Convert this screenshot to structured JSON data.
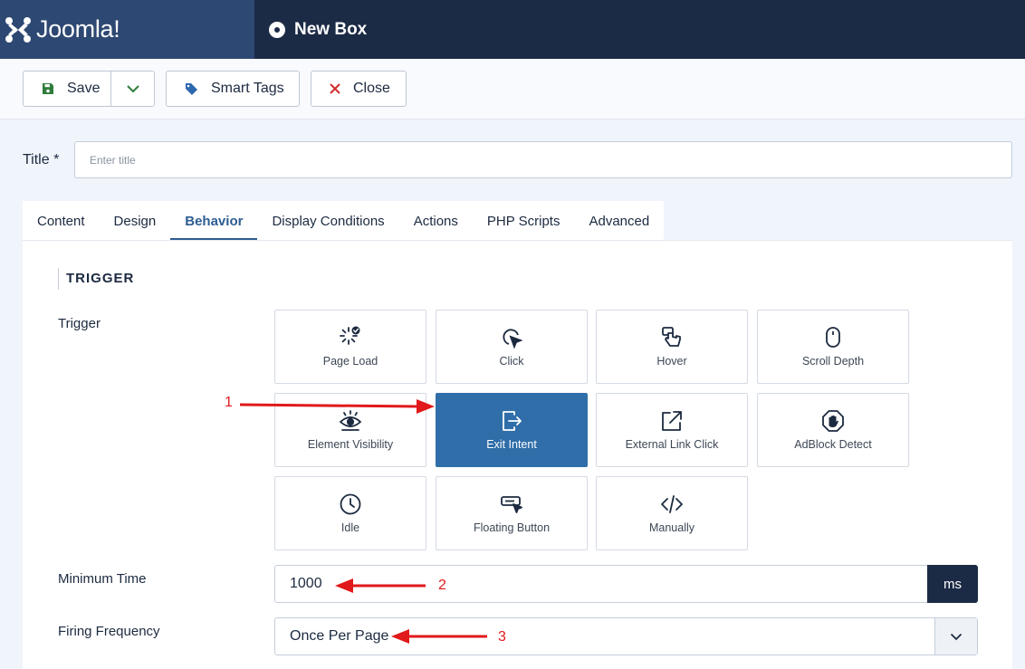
{
  "header": {
    "logo_text": "Joomla!",
    "page_title": "New Box"
  },
  "toolbar": {
    "save_label": "Save",
    "smart_tags_label": "Smart Tags",
    "close_label": "Close"
  },
  "title_field": {
    "label": "Title *",
    "placeholder": "Enter title",
    "value": ""
  },
  "tabs": [
    "Content",
    "Design",
    "Behavior",
    "Display Conditions",
    "Actions",
    "PHP Scripts",
    "Advanced"
  ],
  "active_tab": "Behavior",
  "section": {
    "heading": "TRIGGER"
  },
  "trigger": {
    "label": "Trigger",
    "options": [
      {
        "label": "Page Load",
        "icon": "page-load-icon"
      },
      {
        "label": "Click",
        "icon": "click-cursor-icon"
      },
      {
        "label": "Hover",
        "icon": "hover-hand-icon"
      },
      {
        "label": "Scroll Depth",
        "icon": "mouse-icon"
      },
      {
        "label": "Element Visibility",
        "icon": "eye-icon"
      },
      {
        "label": "Exit Intent",
        "icon": "exit-icon"
      },
      {
        "label": "External Link Click",
        "icon": "external-link-icon"
      },
      {
        "label": "AdBlock Detect",
        "icon": "adblock-hand-icon"
      },
      {
        "label": "Idle",
        "icon": "clock-icon"
      },
      {
        "label": "Floating Button",
        "icon": "floating-button-icon"
      },
      {
        "label": "Manually",
        "icon": "code-icon"
      }
    ],
    "selected": "Exit Intent"
  },
  "minimum_time": {
    "label": "Minimum Time",
    "value": "1000",
    "unit": "ms"
  },
  "firing_frequency": {
    "label": "Firing Frequency",
    "value": "Once Per Page"
  },
  "annotations": {
    "one": "1",
    "two": "2",
    "three": "3",
    "color": "#e1191b"
  }
}
